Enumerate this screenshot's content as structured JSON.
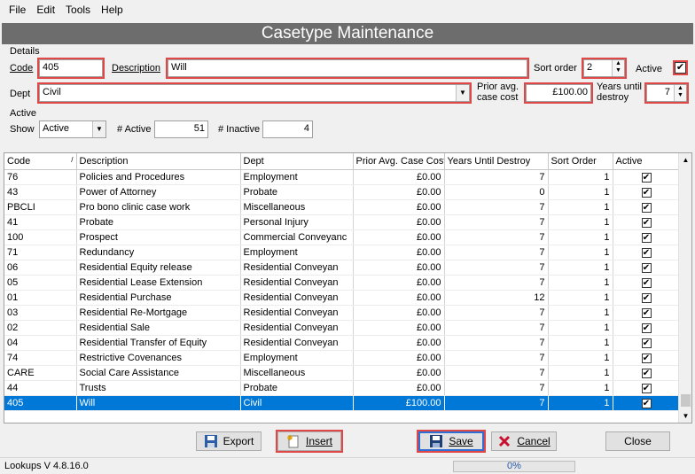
{
  "menu": [
    "File",
    "Edit",
    "Tools",
    "Help"
  ],
  "window_title": "Casetype Maintenance",
  "details": {
    "group_label": "Details",
    "code_label": "Code",
    "code_value": "405",
    "description_label": "Description",
    "description_value": "Will",
    "sort_order_label": "Sort order",
    "sort_order_value": "2",
    "active_label": "Active",
    "active_checked": true,
    "dept_label": "Dept",
    "dept_value": "Civil",
    "prior_avg_label_1": "Prior avg.",
    "prior_avg_label_2": "case cost",
    "prior_avg_value": "£100.00",
    "years_label_1": "Years until",
    "years_label_2": "destroy",
    "years_value": "7"
  },
  "active_filter": {
    "group_label": "Active",
    "show_label": "Show",
    "show_value": "Active",
    "num_active_label": "# Active",
    "num_active_value": "51",
    "num_inactive_label": "# Inactive",
    "num_inactive_value": "4"
  },
  "table": {
    "columns": [
      "Code",
      "Description",
      "Dept",
      "Prior Avg. Case Cost",
      "Years Until Destroy",
      "Sort Order",
      "Active"
    ],
    "rows": [
      {
        "code": "76",
        "description": "Policies and Procedures",
        "dept": "Employment",
        "cost": "£0.00",
        "years": "7",
        "sort": "1",
        "active": true
      },
      {
        "code": "43",
        "description": "Power of Attorney",
        "dept": "Probate",
        "cost": "£0.00",
        "years": "0",
        "sort": "1",
        "active": true
      },
      {
        "code": "PBCLI",
        "description": "Pro bono clinic case work",
        "dept": "Miscellaneous",
        "cost": "£0.00",
        "years": "7",
        "sort": "1",
        "active": true
      },
      {
        "code": "41",
        "description": "Probate",
        "dept": "Personal Injury",
        "cost": "£0.00",
        "years": "7",
        "sort": "1",
        "active": true
      },
      {
        "code": "100",
        "description": "Prospect",
        "dept": "Commercial Conveyanc",
        "cost": "£0.00",
        "years": "7",
        "sort": "1",
        "active": true
      },
      {
        "code": "71",
        "description": "Redundancy",
        "dept": "Employment",
        "cost": "£0.00",
        "years": "7",
        "sort": "1",
        "active": true
      },
      {
        "code": "06",
        "description": "Residential Equity release",
        "dept": "Residential Conveyan",
        "cost": "£0.00",
        "years": "7",
        "sort": "1",
        "active": true
      },
      {
        "code": "05",
        "description": "Residential Lease Extension",
        "dept": "Residential Conveyan",
        "cost": "£0.00",
        "years": "7",
        "sort": "1",
        "active": true
      },
      {
        "code": "01",
        "description": "Residential Purchase",
        "dept": "Residential Conveyan",
        "cost": "£0.00",
        "years": "12",
        "sort": "1",
        "active": true
      },
      {
        "code": "03",
        "description": "Residential Re-Mortgage",
        "dept": "Residential Conveyan",
        "cost": "£0.00",
        "years": "7",
        "sort": "1",
        "active": true
      },
      {
        "code": "02",
        "description": "Residential Sale",
        "dept": "Residential Conveyan",
        "cost": "£0.00",
        "years": "7",
        "sort": "1",
        "active": true
      },
      {
        "code": "04",
        "description": "Residential Transfer of Equity",
        "dept": "Residential Conveyan",
        "cost": "£0.00",
        "years": "7",
        "sort": "1",
        "active": true
      },
      {
        "code": "74",
        "description": "Restrictive Covenances",
        "dept": "Employment",
        "cost": "£0.00",
        "years": "7",
        "sort": "1",
        "active": true
      },
      {
        "code": "CARE",
        "description": "Social Care Assistance",
        "dept": "Miscellaneous",
        "cost": "£0.00",
        "years": "7",
        "sort": "1",
        "active": true
      },
      {
        "code": "44",
        "description": "Trusts",
        "dept": "Probate",
        "cost": "£0.00",
        "years": "7",
        "sort": "1",
        "active": true
      },
      {
        "code": "405",
        "description": "Will",
        "dept": "Civil",
        "cost": "£100.00",
        "years": "7",
        "sort": "1",
        "active": true,
        "selected": true
      }
    ]
  },
  "buttons": {
    "export": "Export",
    "insert": "Insert",
    "save": "Save",
    "cancel": "Cancel",
    "close": "Close"
  },
  "status": {
    "version": "Lookups V 4.8.16.0",
    "progress_text": "0%",
    "progress_value": 0
  },
  "colors": {
    "title_bar": "#6d6d6d",
    "highlight_box": "#e04848",
    "selected_row": "#0078d7"
  }
}
